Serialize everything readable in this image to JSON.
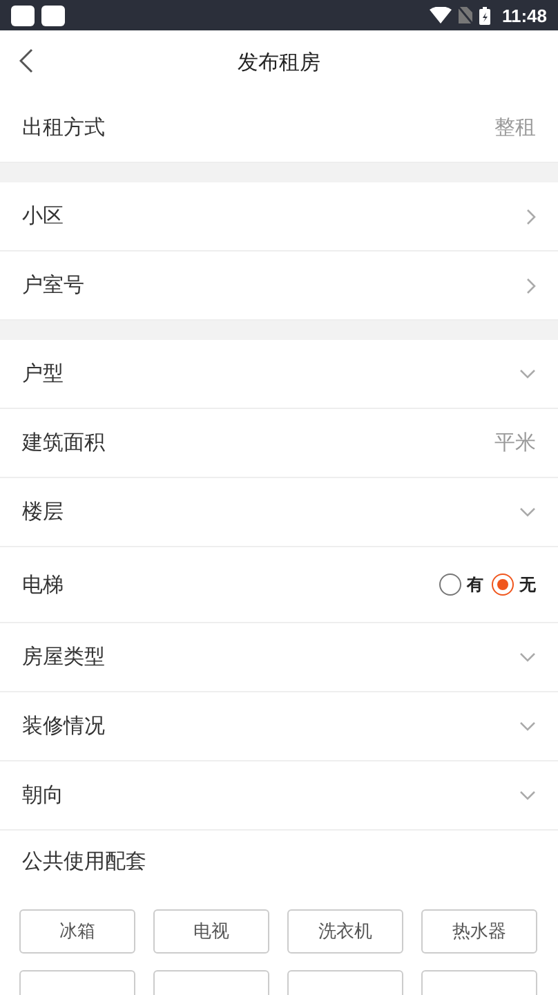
{
  "status_bar": {
    "time": "11:48"
  },
  "nav": {
    "title": "发布租房"
  },
  "sections": [
    {
      "rows": [
        {
          "kind": "value",
          "label": "出租方式",
          "value": "整租"
        }
      ]
    },
    {
      "rows": [
        {
          "kind": "link",
          "label": "小区"
        },
        {
          "kind": "link",
          "label": "户室号"
        }
      ]
    },
    {
      "rows": [
        {
          "kind": "select",
          "label": "户型"
        },
        {
          "kind": "value",
          "label": "建筑面积",
          "value": "平米"
        },
        {
          "kind": "select",
          "label": "楼层"
        },
        {
          "kind": "radio",
          "label": "电梯",
          "options": [
            {
              "label": "有",
              "selected": false
            },
            {
              "label": "无",
              "selected": true
            }
          ]
        },
        {
          "kind": "select",
          "label": "房屋类型"
        },
        {
          "kind": "select",
          "label": "装修情况"
        },
        {
          "kind": "select",
          "label": "朝向"
        }
      ]
    }
  ],
  "facilities": {
    "title": "公共使用配套",
    "items": [
      {
        "kind": "labeled",
        "label": "冰箱"
      },
      {
        "kind": "labeled",
        "label": "电视"
      },
      {
        "kind": "labeled",
        "label": "洗衣机"
      },
      {
        "kind": "labeled",
        "label": "热水器"
      },
      {
        "kind": "cut_off"
      },
      {
        "kind": "cut_off"
      },
      {
        "kind": "cut_off"
      },
      {
        "kind": "cut_off"
      }
    ]
  }
}
